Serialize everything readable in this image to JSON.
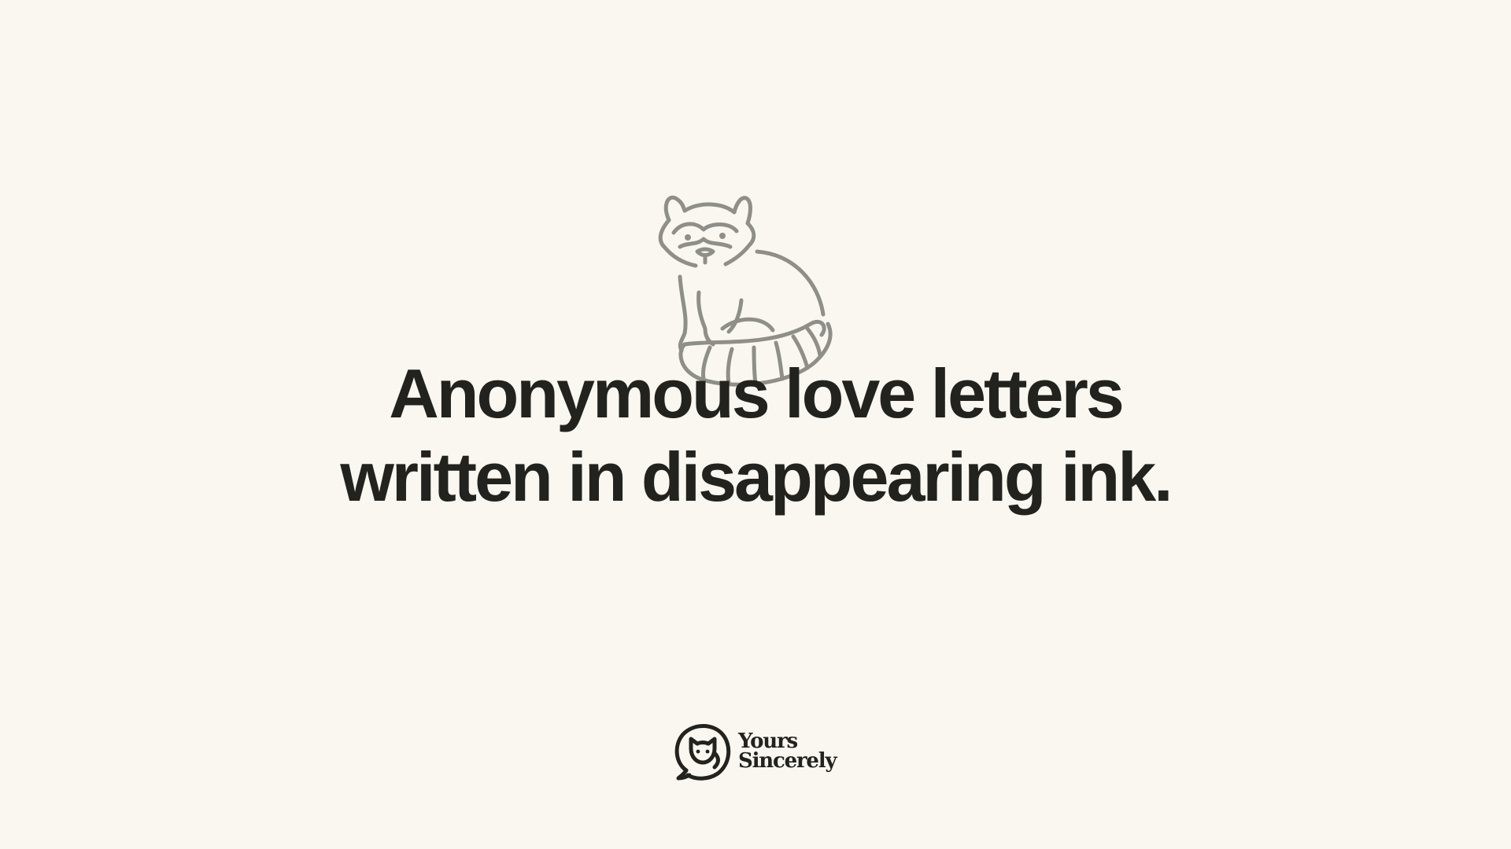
{
  "hero": {
    "illustration_icon": "raccoon-icon",
    "headline_line1": "Anonymous love letters",
    "headline_line2": "written in disappearing ink."
  },
  "brand": {
    "logo_icon": "cat-speech-bubble-icon",
    "name_line1": "Yours",
    "name_line2": "Sincerely"
  },
  "colors": {
    "background": "#f9f7f0",
    "text": "#22231f",
    "illustration_stroke": "#8f8f8a"
  }
}
